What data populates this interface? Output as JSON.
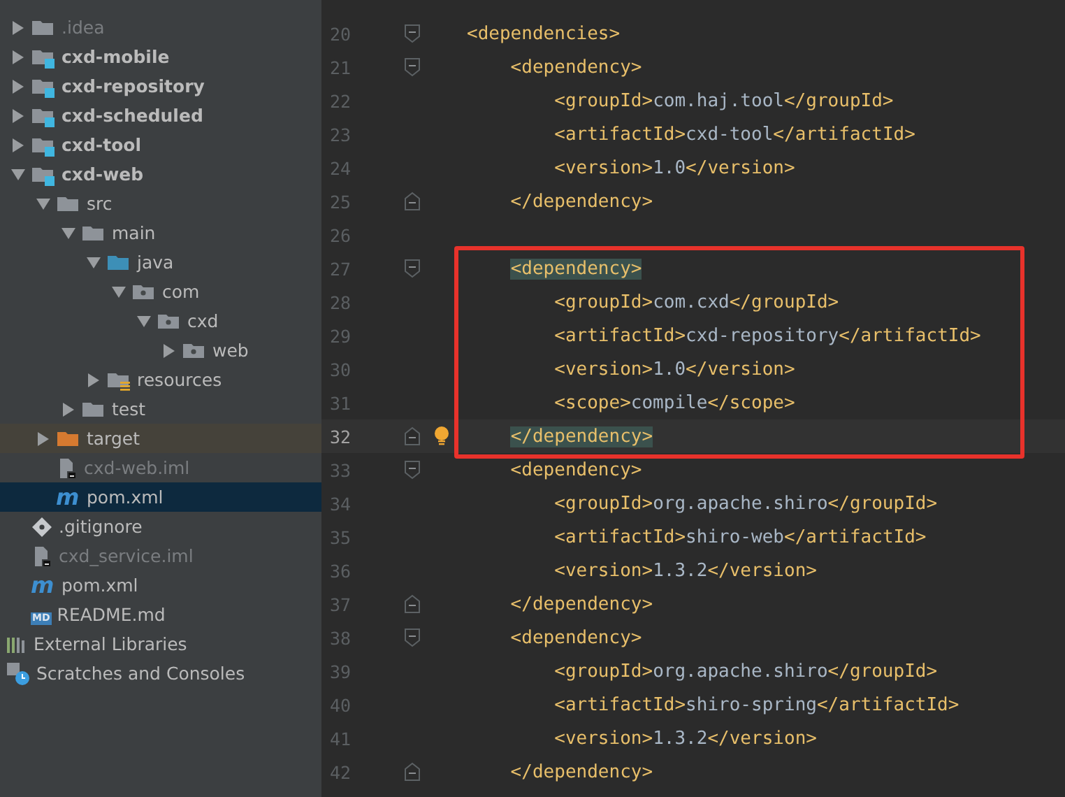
{
  "project_tree": [
    {
      "label": ".idea",
      "kind": "folder",
      "expanded": false,
      "selected": false
    },
    {
      "label": "cxd-mobile",
      "kind": "module",
      "expanded": false,
      "selected": false
    },
    {
      "label": "cxd-repository",
      "kind": "module",
      "expanded": false,
      "selected": false
    },
    {
      "label": "cxd-scheduled",
      "kind": "module",
      "expanded": false,
      "selected": false
    },
    {
      "label": "cxd-tool",
      "kind": "module",
      "expanded": false,
      "selected": false
    },
    {
      "label": "cxd-web",
      "kind": "module",
      "expanded": true,
      "selected": false,
      "children": [
        {
          "label": "src",
          "kind": "folder",
          "expanded": true,
          "selected": false,
          "children": [
            {
              "label": "main",
              "kind": "folder",
              "expanded": true,
              "selected": false,
              "children": [
                {
                  "label": "java",
                  "kind": "source-folder",
                  "expanded": true,
                  "selected": false,
                  "children": [
                    {
                      "label": "com",
                      "kind": "package",
                      "expanded": true,
                      "selected": false,
                      "children": [
                        {
                          "label": "cxd",
                          "kind": "package",
                          "expanded": true,
                          "selected": false,
                          "children": [
                            {
                              "label": "web",
                              "kind": "package",
                              "expanded": false,
                              "selected": false
                            }
                          ]
                        }
                      ]
                    }
                  ]
                },
                {
                  "label": "resources",
                  "kind": "resources-folder",
                  "expanded": false,
                  "selected": false
                }
              ]
            },
            {
              "label": "test",
              "kind": "folder",
              "expanded": false,
              "selected": false
            }
          ]
        },
        {
          "label": "target",
          "kind": "excluded-folder",
          "expanded": false,
          "selected": false
        },
        {
          "label": "cxd-web.iml",
          "kind": "iml-file",
          "selected": false
        },
        {
          "label": "pom.xml",
          "kind": "maven-file",
          "icon_text": "m",
          "selected": true
        }
      ]
    },
    {
      "label": ".gitignore",
      "kind": "git-file",
      "selected": false
    },
    {
      "label": "cxd_service.iml",
      "kind": "iml-file",
      "selected": false
    },
    {
      "label": "pom.xml",
      "kind": "maven-file",
      "icon_text": "m",
      "selected": false
    },
    {
      "label": "README.md",
      "kind": "markdown-file",
      "icon_text": "MD",
      "selected": false
    },
    {
      "label": "External Libraries",
      "kind": "libraries",
      "selected": false
    },
    {
      "label": "Scratches and Consoles",
      "kind": "scratches",
      "selected": false
    }
  ],
  "editor": {
    "lines": [
      {
        "number": "20",
        "kind": "opening",
        "segments": [
          {
            "kind": "tag",
            "text": "<dependencies>"
          }
        ]
      },
      {
        "number": "21",
        "kind": "opening",
        "segments": [
          {
            "kind": "tag",
            "text": "    <dependency>"
          }
        ]
      },
      {
        "number": "22",
        "kind": "plain",
        "segments": [
          {
            "kind": "tag",
            "text": "        <groupId>"
          },
          {
            "kind": "value",
            "text": "com.haj.tool"
          },
          {
            "kind": "tag",
            "text": "</groupId>"
          }
        ]
      },
      {
        "number": "23",
        "kind": "plain",
        "segments": [
          {
            "kind": "tag",
            "text": "        <artifactId>"
          },
          {
            "kind": "value",
            "text": "cxd-tool"
          },
          {
            "kind": "tag",
            "text": "</artifactId>"
          }
        ]
      },
      {
        "number": "24",
        "kind": "plain",
        "segments": [
          {
            "kind": "tag",
            "text": "        <version>"
          },
          {
            "kind": "value",
            "text": "1.0"
          },
          {
            "kind": "tag",
            "text": "</version>"
          }
        ]
      },
      {
        "number": "25",
        "kind": "closing",
        "segments": [
          {
            "kind": "tag",
            "text": "    </dependency>"
          }
        ]
      },
      {
        "number": "26",
        "kind": "plain"
      },
      {
        "number": "27",
        "kind": "opening",
        "framed": true,
        "segments": [
          {
            "kind": "matched-tag",
            "text": "    <dependency>"
          }
        ]
      },
      {
        "number": "28",
        "kind": "plain",
        "framed": true,
        "segments": [
          {
            "kind": "tag",
            "text": "        <groupId>"
          },
          {
            "kind": "value",
            "text": "com.cxd"
          },
          {
            "kind": "tag",
            "text": "</groupId>"
          }
        ]
      },
      {
        "number": "29",
        "kind": "plain",
        "framed": true,
        "segments": [
          {
            "kind": "tag",
            "text": "        <artifactId>"
          },
          {
            "kind": "value",
            "text": "cxd-repository"
          },
          {
            "kind": "tag",
            "text": "</artifactId>"
          }
        ]
      },
      {
        "number": "30",
        "kind": "plain",
        "framed": true,
        "segments": [
          {
            "kind": "tag",
            "text": "        <version>"
          },
          {
            "kind": "value",
            "text": "1.0"
          },
          {
            "kind": "tag",
            "text": "</version>"
          }
        ]
      },
      {
        "number": "31",
        "kind": "plain",
        "framed": true,
        "segments": [
          {
            "kind": "tag",
            "text": "        <scope>"
          },
          {
            "kind": "value",
            "text": "compile"
          },
          {
            "kind": "tag",
            "text": "</scope>"
          }
        ]
      },
      {
        "number": "32",
        "kind": "closing",
        "framed": true,
        "current": true,
        "bulb": true,
        "segments": [
          {
            "kind": "matched-tag",
            "text": "    </dependency>"
          }
        ]
      },
      {
        "number": "33",
        "kind": "opening",
        "segments": [
          {
            "kind": "tag",
            "text": "    <dependency>"
          }
        ]
      },
      {
        "number": "34",
        "kind": "plain",
        "segments": [
          {
            "kind": "tag",
            "text": "        <groupId>"
          },
          {
            "kind": "value",
            "text": "org.apache.shiro"
          },
          {
            "kind": "tag",
            "text": "</groupId>"
          }
        ]
      },
      {
        "number": "35",
        "kind": "plain",
        "segments": [
          {
            "kind": "tag",
            "text": "        <artifactId>"
          },
          {
            "kind": "value",
            "text": "shiro-web"
          },
          {
            "kind": "tag",
            "text": "</artifactId>"
          }
        ]
      },
      {
        "number": "36",
        "kind": "plain",
        "segments": [
          {
            "kind": "tag",
            "text": "        <version>"
          },
          {
            "kind": "value",
            "text": "1.3.2"
          },
          {
            "kind": "tag",
            "text": "</version>"
          }
        ]
      },
      {
        "number": "37",
        "kind": "closing",
        "segments": [
          {
            "kind": "tag",
            "text": "    </dependency>"
          }
        ]
      },
      {
        "number": "38",
        "kind": "opening",
        "segments": [
          {
            "kind": "tag",
            "text": "    <dependency>"
          }
        ]
      },
      {
        "number": "39",
        "kind": "plain",
        "segments": [
          {
            "kind": "tag",
            "text": "        <groupId>"
          },
          {
            "kind": "value",
            "text": "org.apache.shiro"
          },
          {
            "kind": "tag",
            "text": "</groupId>"
          }
        ]
      },
      {
        "number": "40",
        "kind": "plain",
        "segments": [
          {
            "kind": "tag",
            "text": "        <artifactId>"
          },
          {
            "kind": "value",
            "text": "shiro-spring"
          },
          {
            "kind": "tag",
            "text": "</artifactId>"
          }
        ]
      },
      {
        "number": "41",
        "kind": "plain",
        "segments": [
          {
            "kind": "tag",
            "text": "        <version>"
          },
          {
            "kind": "value",
            "text": "1.3.2"
          },
          {
            "kind": "tag",
            "text": "</version>"
          }
        ]
      },
      {
        "number": "42",
        "kind": "closing",
        "segments": [
          {
            "kind": "tag",
            "text": "    </dependency>"
          }
        ]
      }
    ]
  }
}
